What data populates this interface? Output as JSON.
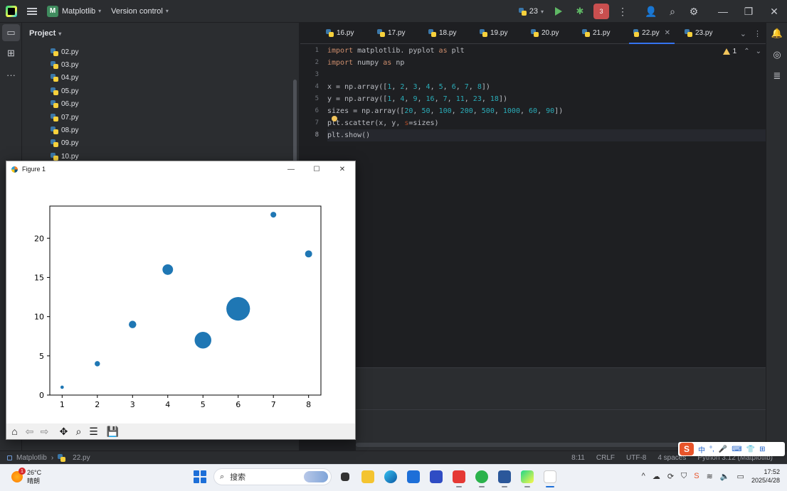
{
  "titlebar": {
    "project_badge": "M",
    "project_name": "Matplotlib",
    "vcs_label": "Version control",
    "python_count": "23",
    "stop_badge": "3"
  },
  "project_panel": {
    "header": "Project",
    "files": [
      "02.py",
      "03.py",
      "04.py",
      "05.py",
      "06.py",
      "07.py",
      "08.py",
      "09.py",
      "10.py"
    ]
  },
  "editor": {
    "tabs": [
      {
        "label": "16.py",
        "active": false
      },
      {
        "label": "17.py",
        "active": false
      },
      {
        "label": "18.py",
        "active": false
      },
      {
        "label": "19.py",
        "active": false
      },
      {
        "label": "20.py",
        "active": false
      },
      {
        "label": "21.py",
        "active": false
      },
      {
        "label": "22.py",
        "active": true
      },
      {
        "label": "23.py",
        "active": false
      }
    ],
    "line_numbers": [
      "1",
      "2",
      "3",
      "4",
      "5",
      "6",
      "7",
      "8"
    ],
    "warning_count": "1",
    "code_lines": [
      "import matplotlib. pyplot as plt",
      "import numpy as np",
      "",
      "x = np.array([1, 2, 3, 4, 5, 6, 7, 8])",
      "y = np.array([1, 4, 9, 16, 7, 11, 23, 18])",
      "sizes = np.array([20, 50, 100, 200, 500, 1000, 60, 90])",
      "plt.scatter(x, y, s=sizes)",
      "plt.show()"
    ]
  },
  "figure_window": {
    "title": "Figure 1"
  },
  "chart_data": {
    "type": "scatter",
    "x": [
      1,
      2,
      3,
      4,
      5,
      6,
      7,
      8
    ],
    "y": [
      1,
      4,
      9,
      16,
      7,
      11,
      23,
      18
    ],
    "sizes": [
      20,
      50,
      100,
      200,
      500,
      1000,
      60,
      90
    ],
    "xlim": [
      0.65,
      8.35
    ],
    "ylim": [
      0,
      24.1
    ],
    "xticks": [
      "1",
      "2",
      "3",
      "4",
      "5",
      "6",
      "7",
      "8"
    ],
    "yticks": [
      "0",
      "5",
      "10",
      "15",
      "20"
    ],
    "ytick_values": [
      0,
      5,
      10,
      15,
      20
    ],
    "color": "#1f77b4",
    "title": "",
    "xlabel": "",
    "ylabel": ""
  },
  "statusbar": {
    "project": "Matplotlib",
    "file": "22.py",
    "position": "8:11",
    "line_sep": "CRLF",
    "encoding": "UTF-8",
    "indent": "4 spaces",
    "interpreter": "Python 3.12 (Matplotlib)"
  },
  "taskbar": {
    "weather_temp": "26°C",
    "weather_desc": "晴朗",
    "weather_badge": "1",
    "search_placeholder": "搜索",
    "time": "17:52",
    "date": "2025/4/28",
    "ime_mode": "中"
  }
}
